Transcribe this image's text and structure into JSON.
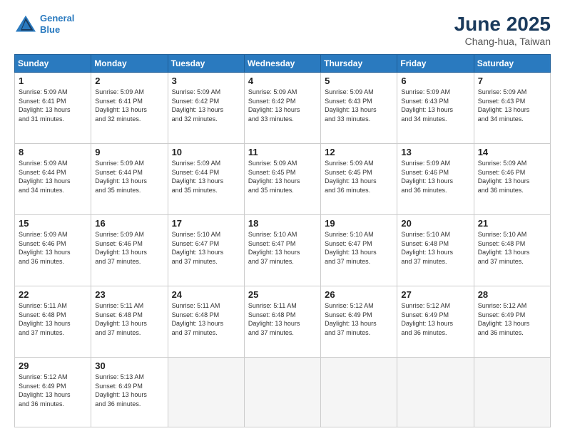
{
  "logo": {
    "line1": "General",
    "line2": "Blue"
  },
  "title": "June 2025",
  "subtitle": "Chang-hua, Taiwan",
  "weekdays": [
    "Sunday",
    "Monday",
    "Tuesday",
    "Wednesday",
    "Thursday",
    "Friday",
    "Saturday"
  ],
  "weeks": [
    [
      {
        "day": "1",
        "info": "Sunrise: 5:09 AM\nSunset: 6:41 PM\nDaylight: 13 hours\nand 31 minutes."
      },
      {
        "day": "2",
        "info": "Sunrise: 5:09 AM\nSunset: 6:41 PM\nDaylight: 13 hours\nand 32 minutes."
      },
      {
        "day": "3",
        "info": "Sunrise: 5:09 AM\nSunset: 6:42 PM\nDaylight: 13 hours\nand 32 minutes."
      },
      {
        "day": "4",
        "info": "Sunrise: 5:09 AM\nSunset: 6:42 PM\nDaylight: 13 hours\nand 33 minutes."
      },
      {
        "day": "5",
        "info": "Sunrise: 5:09 AM\nSunset: 6:43 PM\nDaylight: 13 hours\nand 33 minutes."
      },
      {
        "day": "6",
        "info": "Sunrise: 5:09 AM\nSunset: 6:43 PM\nDaylight: 13 hours\nand 34 minutes."
      },
      {
        "day": "7",
        "info": "Sunrise: 5:09 AM\nSunset: 6:43 PM\nDaylight: 13 hours\nand 34 minutes."
      }
    ],
    [
      {
        "day": "8",
        "info": "Sunrise: 5:09 AM\nSunset: 6:44 PM\nDaylight: 13 hours\nand 34 minutes."
      },
      {
        "day": "9",
        "info": "Sunrise: 5:09 AM\nSunset: 6:44 PM\nDaylight: 13 hours\nand 35 minutes."
      },
      {
        "day": "10",
        "info": "Sunrise: 5:09 AM\nSunset: 6:44 PM\nDaylight: 13 hours\nand 35 minutes."
      },
      {
        "day": "11",
        "info": "Sunrise: 5:09 AM\nSunset: 6:45 PM\nDaylight: 13 hours\nand 35 minutes."
      },
      {
        "day": "12",
        "info": "Sunrise: 5:09 AM\nSunset: 6:45 PM\nDaylight: 13 hours\nand 36 minutes."
      },
      {
        "day": "13",
        "info": "Sunrise: 5:09 AM\nSunset: 6:46 PM\nDaylight: 13 hours\nand 36 minutes."
      },
      {
        "day": "14",
        "info": "Sunrise: 5:09 AM\nSunset: 6:46 PM\nDaylight: 13 hours\nand 36 minutes."
      }
    ],
    [
      {
        "day": "15",
        "info": "Sunrise: 5:09 AM\nSunset: 6:46 PM\nDaylight: 13 hours\nand 36 minutes."
      },
      {
        "day": "16",
        "info": "Sunrise: 5:09 AM\nSunset: 6:46 PM\nDaylight: 13 hours\nand 37 minutes."
      },
      {
        "day": "17",
        "info": "Sunrise: 5:10 AM\nSunset: 6:47 PM\nDaylight: 13 hours\nand 37 minutes."
      },
      {
        "day": "18",
        "info": "Sunrise: 5:10 AM\nSunset: 6:47 PM\nDaylight: 13 hours\nand 37 minutes."
      },
      {
        "day": "19",
        "info": "Sunrise: 5:10 AM\nSunset: 6:47 PM\nDaylight: 13 hours\nand 37 minutes."
      },
      {
        "day": "20",
        "info": "Sunrise: 5:10 AM\nSunset: 6:48 PM\nDaylight: 13 hours\nand 37 minutes."
      },
      {
        "day": "21",
        "info": "Sunrise: 5:10 AM\nSunset: 6:48 PM\nDaylight: 13 hours\nand 37 minutes."
      }
    ],
    [
      {
        "day": "22",
        "info": "Sunrise: 5:11 AM\nSunset: 6:48 PM\nDaylight: 13 hours\nand 37 minutes."
      },
      {
        "day": "23",
        "info": "Sunrise: 5:11 AM\nSunset: 6:48 PM\nDaylight: 13 hours\nand 37 minutes."
      },
      {
        "day": "24",
        "info": "Sunrise: 5:11 AM\nSunset: 6:48 PM\nDaylight: 13 hours\nand 37 minutes."
      },
      {
        "day": "25",
        "info": "Sunrise: 5:11 AM\nSunset: 6:48 PM\nDaylight: 13 hours\nand 37 minutes."
      },
      {
        "day": "26",
        "info": "Sunrise: 5:12 AM\nSunset: 6:49 PM\nDaylight: 13 hours\nand 37 minutes."
      },
      {
        "day": "27",
        "info": "Sunrise: 5:12 AM\nSunset: 6:49 PM\nDaylight: 13 hours\nand 36 minutes."
      },
      {
        "day": "28",
        "info": "Sunrise: 5:12 AM\nSunset: 6:49 PM\nDaylight: 13 hours\nand 36 minutes."
      }
    ],
    [
      {
        "day": "29",
        "info": "Sunrise: 5:12 AM\nSunset: 6:49 PM\nDaylight: 13 hours\nand 36 minutes."
      },
      {
        "day": "30",
        "info": "Sunrise: 5:13 AM\nSunset: 6:49 PM\nDaylight: 13 hours\nand 36 minutes."
      },
      {
        "day": "",
        "info": ""
      },
      {
        "day": "",
        "info": ""
      },
      {
        "day": "",
        "info": ""
      },
      {
        "day": "",
        "info": ""
      },
      {
        "day": "",
        "info": ""
      }
    ]
  ]
}
